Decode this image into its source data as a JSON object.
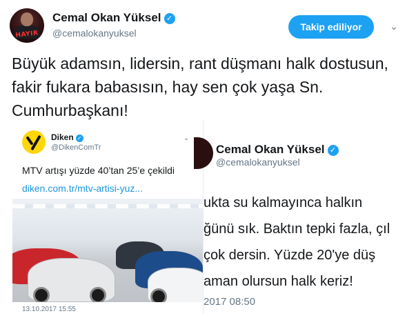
{
  "header": {
    "display_name": "Cemal Okan Yüksel",
    "handle": "@cemalokanyuksel",
    "follow_label": "Takip ediliyor",
    "avatar_caption": "HAYIR"
  },
  "tweet": {
    "text": "Büyük adamsın, lidersin, rant düşmanı halk dostusun, fakir fukara babasısın, hay sen çok yaşa Sn. Cumhurbaşkanı!"
  },
  "embedded_left": {
    "display_name": "Diken",
    "handle": "@DikenComTr",
    "text": "MTV artışı yüzde 40’tan 25’e çekildi",
    "link": "diken.com.tr/mtv-artisi-yuz...",
    "timestamp": "13.10.2017 15:55"
  },
  "embedded_right": {
    "display_name": "Cemal Okan Yüksel",
    "handle": "@cemalokanyuksel",
    "lines": [
      "ukta su kalmayınca halkın",
      "ğünü sık. Baktın tepki fazla, çıl",
      "çok dersin. Yüzde 20'ye düş",
      "aman olursun halk keriz!"
    ],
    "timestamp": "2017 08:50"
  },
  "colors": {
    "accent": "#1da1f2",
    "link": "#1b95e0",
    "muted": "#657786",
    "text": "#14171a"
  }
}
